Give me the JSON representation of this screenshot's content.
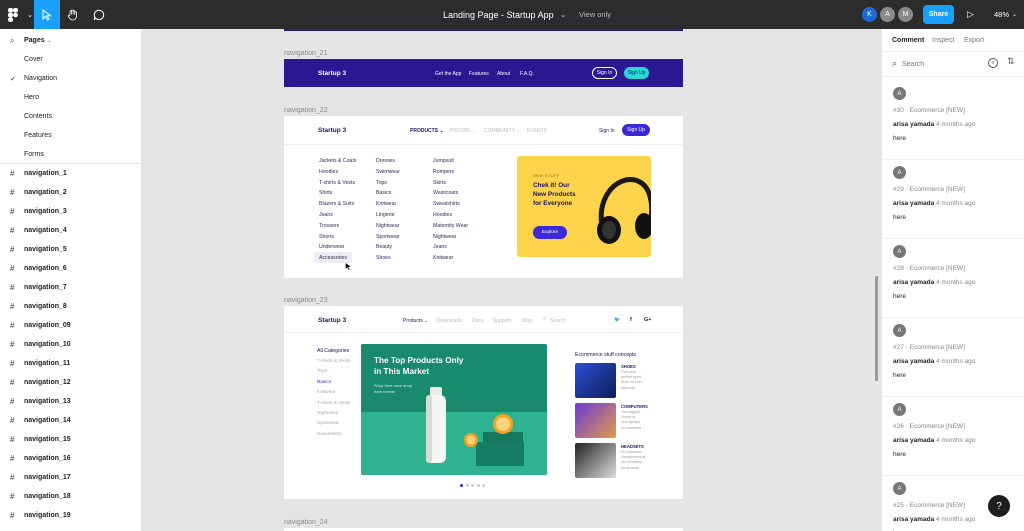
{
  "toolbar": {
    "file_title": "Landing Page - Startup App",
    "title_chevron": "⌄",
    "view_mode": "View only",
    "avatars": [
      {
        "letter": "K",
        "color": "#1f6bd6"
      },
      {
        "letter": "A",
        "color": "#8a8a8a"
      },
      {
        "letter": "M",
        "color": "#8a8a8a"
      }
    ],
    "share_label": "Share",
    "play_glyph": "▷",
    "zoom_label": "48%",
    "icons": {
      "main_menu": "figma-icon",
      "move": "cursor-icon",
      "hand": "hand-icon",
      "comment": "comment-icon"
    }
  },
  "left_panel": {
    "pages_label": "Pages",
    "pages_chevron": "⌄",
    "pages": [
      "Cover",
      "Navigation",
      "Hero",
      "Contents",
      "Features",
      "Forms"
    ],
    "current_page": "Navigation",
    "check": "✓",
    "hash": "#",
    "layers": [
      "navigation_1",
      "navigation_2",
      "navigation_3",
      "navigation_4",
      "navigation_5",
      "navigation_6",
      "navigation_7",
      "navigation_8",
      "navigation_09",
      "navigation_10",
      "navigation_11",
      "navigation_12",
      "navigation_13",
      "navigation_14",
      "navigation_15",
      "navigation_16",
      "navigation_17",
      "navigation_18",
      "navigation_19"
    ]
  },
  "canvas": {
    "frame_labels": {
      "nav21": "navigation_21",
      "nav22": "navigation_22",
      "nav23": "navigation_23",
      "nav24": "navigation_24"
    },
    "nav21": {
      "brand": "Startup 3",
      "menu": [
        "Get the App",
        "Features",
        "About",
        "F.A.Q."
      ],
      "sign_in": "Sign In",
      "sign_up": "Sign Up",
      "bg": "#2a1791",
      "accent": "#2ad7d3"
    },
    "nav22": {
      "brand": "Startup 3",
      "menu": [
        "PRODUCTS ⌄",
        "PRICING ⌄",
        "COMMUNITY ⌄",
        "EVENTS"
      ],
      "sign_in": "Sign In",
      "sign_up": "Sign Up",
      "col1": [
        "Jackets & Coats",
        "Hoodies",
        "T-shirts & Vests",
        "Shirts",
        "Blazers & Suits",
        "Jeans",
        "Trousers",
        "Shorts",
        "Underwear",
        "Accessories"
      ],
      "col2": [
        "Dresses",
        "Swimwear",
        "Tops",
        "Basics",
        "Knitwear",
        "Lingerie",
        "Nightwear",
        "Sportwear",
        "Beauty",
        "Shoes"
      ],
      "col3": [
        "Jumpsuit",
        "Rompers",
        "Skirts",
        "Waistcoats",
        "Sweatshirts",
        "Hoodies",
        "Maternity Wear",
        "Nightwear",
        "Jeans",
        "Knitwear"
      ],
      "promo_kicker": "NEW STUFF",
      "promo_title_1": "Chek it! Our",
      "promo_title_2": "New Products",
      "promo_title_3": "for Everyone",
      "promo_button": "Explore",
      "promo_bg": "#fcd34a",
      "button_color": "#3b28d6"
    },
    "nav23": {
      "brand": "Startup 3",
      "menu": [
        "Products ⌄",
        "Downloads",
        "Docs",
        "Support",
        "Blog"
      ],
      "search_placeholder": "Search",
      "social": [
        "🐦",
        "f",
        "G+"
      ],
      "categories_title": "All Categories",
      "categories": [
        "T-shirts & Vests",
        "Tops",
        "Basics",
        "Knitwear",
        "T-shirts & Vests",
        "Nightwear",
        "Sportwear",
        "Sweatshirts"
      ],
      "hero_title_1": "The Top Products Only",
      "hero_title_2": "in This Market",
      "hero_sub_1": "Shop here once shop",
      "hero_sub_2": "here forever",
      "hero_bg": "#1a8a6e",
      "concepts_title": "Ecommerce stuff concepts",
      "concepts": [
        {
          "title": "SHOES",
          "desc_1": "Find your",
          "desc_2": "perfect sport",
          "desc_3": "shoe for ever",
          "desc_4": "and ever"
        },
        {
          "title": "COMPUTERS",
          "desc_1": "The biggest",
          "desc_2": "choice of",
          "desc_3": "new laptops",
          "desc_4": "for members"
        },
        {
          "title": "HEADSETS",
          "desc_1": "Fit Awesome",
          "desc_2": "Headphones at",
          "desc_3": "our members",
          "desc_4": "every week"
        }
      ]
    }
  },
  "right_panel": {
    "tabs": [
      "Comment",
      "Inspect",
      "Export"
    ],
    "search_placeholder": "Search",
    "comments": [
      {
        "avatar": "A",
        "title": "#30 · Ecommerce [NEW]",
        "user": "arisa yamada",
        "time": "4 months ago",
        "body": "here"
      },
      {
        "avatar": "A",
        "title": "#29 · Ecommerce [NEW]",
        "user": "arisa yamada",
        "time": "4 months ago",
        "body": "here"
      },
      {
        "avatar": "A",
        "title": "#28 · Ecommerce [NEW]",
        "user": "arisa yamada",
        "time": "4 months ago",
        "body": "here"
      },
      {
        "avatar": "A",
        "title": "#27 · Ecommerce [NEW]",
        "user": "arisa yamada",
        "time": "4 months ago",
        "body": "here"
      },
      {
        "avatar": "A",
        "title": "#26 · Ecommerce [NEW]",
        "user": "arisa yamada",
        "time": "4 months ago",
        "body": "here"
      },
      {
        "avatar": "A",
        "title": "#25 · Ecommerce [NEW]",
        "user": "arisa yamada",
        "time": "4 months ago",
        "body": "here"
      }
    ],
    "help_label": "?"
  }
}
